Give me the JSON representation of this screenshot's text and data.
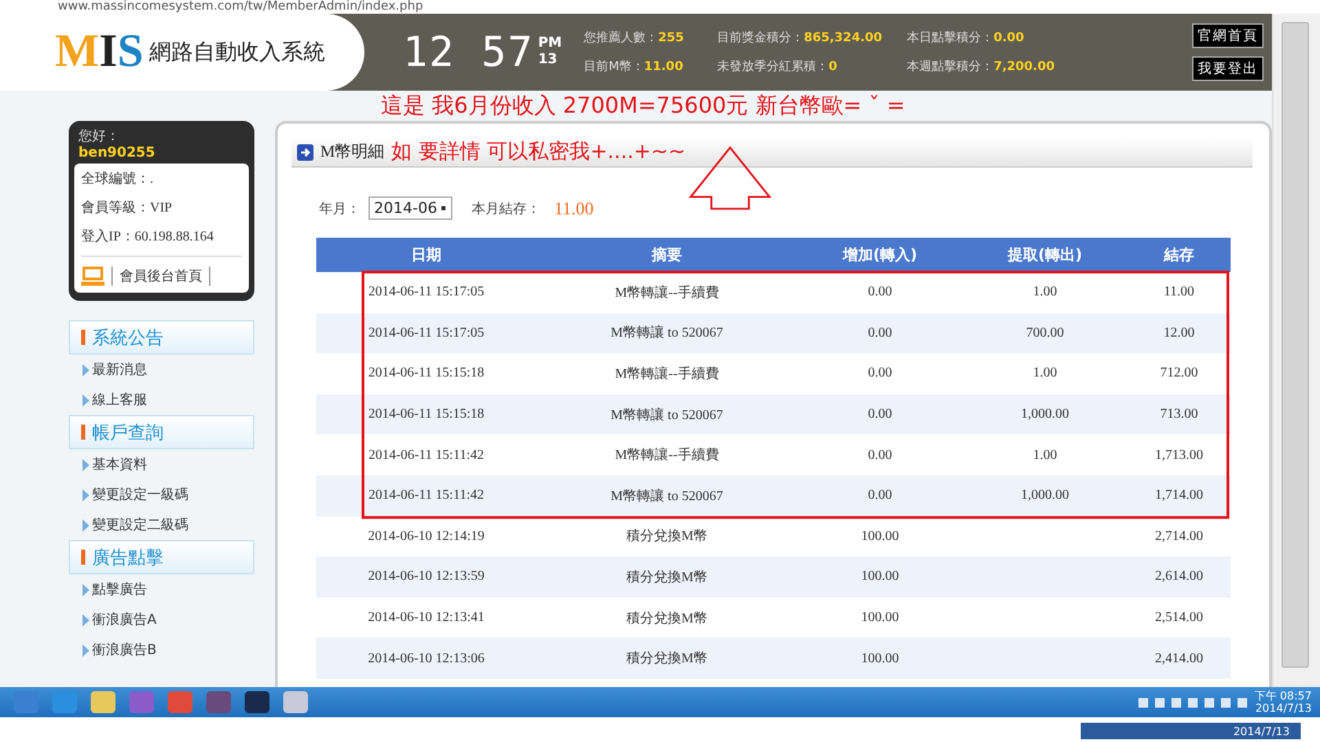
{
  "browser": {
    "url": "www.massincomesystem.com/tw/MemberAdmin/index.php"
  },
  "header": {
    "logo_letters": [
      "M",
      "I",
      "S"
    ],
    "logo_title": "網路自動收入系統",
    "clock": {
      "time": "12 57",
      "ampm": "PM",
      "day": "13"
    },
    "stats": [
      {
        "label": "您推薦人數：",
        "value": "255"
      },
      {
        "label": "目前獎金積分：",
        "value": "865,324.00"
      },
      {
        "label": "本日點擊積分：",
        "value": "0.00"
      },
      {
        "label": "目前M幣：",
        "value": "11.00"
      },
      {
        "label": "未發放季分紅累積：",
        "value": "0"
      },
      {
        "label": "本週點擊積分：",
        "value": "7,200.00"
      }
    ],
    "buttons": [
      "官網首頁",
      "我要登出"
    ]
  },
  "annotation_top": "這是 我6月份收入 2700M=75600元 新台幣歐= ˇ =",
  "user_card": {
    "greeting": "您好：",
    "username": "ben90255",
    "lines": [
      "全球編號：.",
      "會員等級：VIP",
      "登入IP：60.198.88.164"
    ],
    "home_link": "會員後台首頁"
  },
  "sidebar": [
    {
      "title": "系統公告",
      "items": [
        "最新消息",
        "線上客服"
      ]
    },
    {
      "title": "帳戶查詢",
      "items": [
        "基本資料",
        "變更設定一級碼",
        "變更設定二級碼"
      ]
    },
    {
      "title": "廣告點擊",
      "items": [
        "點擊廣告",
        "衝浪廣告A",
        "衝浪廣告B"
      ]
    }
  ],
  "panel": {
    "title": "M幣明細",
    "annotation": "如 要詳情 可以私密我+....+~~",
    "month_label": "年月：",
    "month_value": "2014-06",
    "balance_label": "本月結存：",
    "balance_value": "11.00",
    "table": {
      "columns": [
        "日期",
        "摘要",
        "增加(轉入)",
        "提取(轉出)",
        "結存"
      ],
      "rows": [
        {
          "cells": [
            "2014-06-11 15:17:05",
            "M幣轉讓--手續費",
            "0.00",
            "1.00",
            "11.00"
          ],
          "highlighted": true
        },
        {
          "cells": [
            "2014-06-11 15:17:05",
            "M幣轉讓 to 520067",
            "0.00",
            "700.00",
            "12.00"
          ],
          "highlighted": true
        },
        {
          "cells": [
            "2014-06-11 15:15:18",
            "M幣轉讓--手續費",
            "0.00",
            "1.00",
            "712.00"
          ],
          "highlighted": true
        },
        {
          "cells": [
            "2014-06-11 15:15:18",
            "M幣轉讓 to 520067",
            "0.00",
            "1,000.00",
            "713.00"
          ],
          "highlighted": true
        },
        {
          "cells": [
            "2014-06-11 15:11:42",
            "M幣轉讓--手續費",
            "0.00",
            "1.00",
            "1,713.00"
          ],
          "highlighted": true
        },
        {
          "cells": [
            "2014-06-11 15:11:42",
            "M幣轉讓 to 520067",
            "0.00",
            "1,000.00",
            "1,714.00"
          ],
          "highlighted": true
        },
        {
          "cells": [
            "2014-06-10 12:14:19",
            "積分兌換M幣",
            "100.00",
            "",
            "2,714.00"
          ],
          "highlighted": false
        },
        {
          "cells": [
            "2014-06-10 12:13:59",
            "積分兌換M幣",
            "100.00",
            "",
            "2,614.00"
          ],
          "highlighted": false
        },
        {
          "cells": [
            "2014-06-10 12:13:41",
            "積分兌換M幣",
            "100.00",
            "",
            "2,514.00"
          ],
          "highlighted": false
        },
        {
          "cells": [
            "2014-06-10 12:13:06",
            "積分兌換M幣",
            "100.00",
            "",
            "2,414.00"
          ],
          "highlighted": false
        }
      ]
    }
  },
  "taskbar": {
    "clock_time": "下午 08:57",
    "clock_date": "2014/7/13",
    "ghost_date": "2014/7/13"
  }
}
